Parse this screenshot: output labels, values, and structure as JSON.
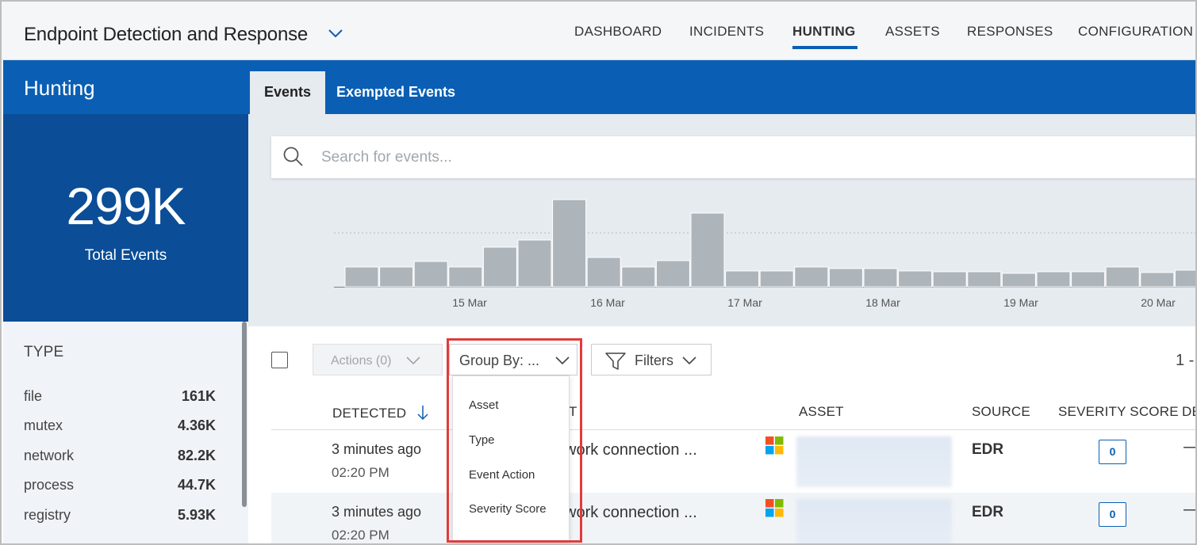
{
  "app": {
    "title": "Endpoint Detection and Response"
  },
  "topnav": {
    "items": [
      {
        "label": "DASHBOARD"
      },
      {
        "label": "INCIDENTS"
      },
      {
        "label": "HUNTING"
      },
      {
        "label": "ASSETS"
      },
      {
        "label": "RESPONSES"
      },
      {
        "label": "CONFIGURATION"
      }
    ],
    "active": "HUNTING"
  },
  "sidebar": {
    "title": "Hunting",
    "total_value": "299K",
    "total_label": "Total Events",
    "type_heading": "TYPE",
    "types": [
      {
        "name": "file",
        "count": "161K"
      },
      {
        "name": "mutex",
        "count": "4.36K"
      },
      {
        "name": "network",
        "count": "82.2K"
      },
      {
        "name": "process",
        "count": "44.7K"
      },
      {
        "name": "registry",
        "count": "5.93K"
      }
    ]
  },
  "tabs": [
    {
      "label": "Events"
    },
    {
      "label": "Exempted Events"
    }
  ],
  "search": {
    "placeholder": "Search for events..."
  },
  "chart_data": {
    "type": "bar",
    "x_tick_labels": [
      "15 Mar",
      "16 Mar",
      "17 Mar",
      "18 Mar",
      "19 Mar",
      "20 Mar"
    ],
    "values": [
      25,
      25,
      32,
      25,
      50,
      59,
      110,
      37,
      25,
      33,
      93,
      20,
      20,
      25,
      23,
      23,
      20,
      19,
      19,
      17,
      19,
      19,
      25,
      18,
      21
    ],
    "bar_color": "#adb5bb",
    "grid": "dotted reference line"
  },
  "toolbar": {
    "actions_label": "Actions (0)",
    "groupby_label": "Group By: ...",
    "filters_label": "Filters",
    "pager_text": "1 -"
  },
  "groupby_options": [
    {
      "label": "Asset"
    },
    {
      "label": "Type"
    },
    {
      "label": "Event Action"
    },
    {
      "label": "Severity Score"
    }
  ],
  "table": {
    "headers": {
      "detected": "DETECTED",
      "event": "T",
      "asset": "ASSET",
      "source": "SOURCE",
      "severity": "SEVERITY SCORE",
      "extra": "DET"
    },
    "rows": [
      {
        "relative": "3 minutes ago",
        "time": "02:20 PM",
        "description": "work connection ...",
        "source": "EDR",
        "severity": "0",
        "extra": "—"
      },
      {
        "relative": "3 minutes ago",
        "time": "02:20 PM",
        "description": "work connection ...",
        "source": "EDR",
        "severity": "0",
        "extra": "—"
      }
    ]
  },
  "colors": {
    "primary": "#0a5fb4",
    "primary_dark": "#0b4d97",
    "highlight": "#e03c3c"
  }
}
